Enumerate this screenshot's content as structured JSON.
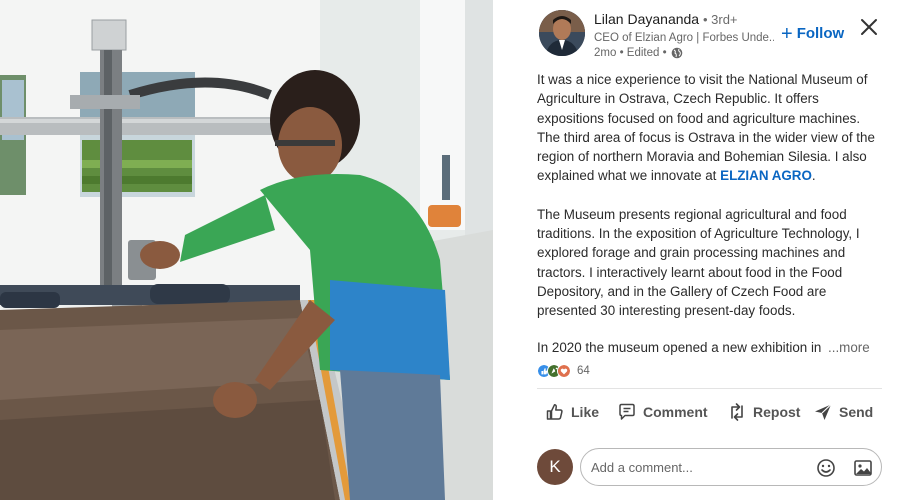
{
  "post": {
    "author": {
      "name": "Lilan Dayananda",
      "degree": "• 3rd+",
      "headline": "CEO of Elzian Agro | Forbes Unde...",
      "time": "2mo • Edited •"
    },
    "follow_label": "Follow",
    "body": {
      "p1_before": "It was a nice experience to visit the National Museum of Agriculture in Ostrava, Czech Republic. It offers expositions focused on food and agriculture machines. The third area of focus is Ostrava in the wider view of the region of northern Moravia and Bohemian Silesia. I also explained what we innovate at ",
      "p1_mention": "ELZIAN AGRO",
      "p1_after": ".",
      "p2": "The Museum presents regional agricultural and food traditions. In the exposition of Agriculture Technology, I explored forage and grain processing machines and tractors. I interactively learnt about food in the Food Depository, and in the Gallery of Czech Food are presented 30 interesting present-day foods.",
      "p3_truncated": "In 2020 the museum opened a new exhibition in",
      "see_more": "...more"
    },
    "reactions": {
      "count": "64",
      "icons": [
        "like-icon",
        "celebrate-icon",
        "love-icon"
      ]
    },
    "actions": {
      "like": "Like",
      "comment": "Comment",
      "repost": "Repost",
      "send": "Send"
    },
    "comment": {
      "avatar_initial": "K",
      "placeholder": "Add a comment..."
    }
  },
  "colors": {
    "brand_blue": "#0a66c2",
    "text": "#2b2b2b",
    "muted": "#666666",
    "like_blue": "#378fe9",
    "celebrate_green": "#44712e",
    "love_red": "#df704d"
  }
}
